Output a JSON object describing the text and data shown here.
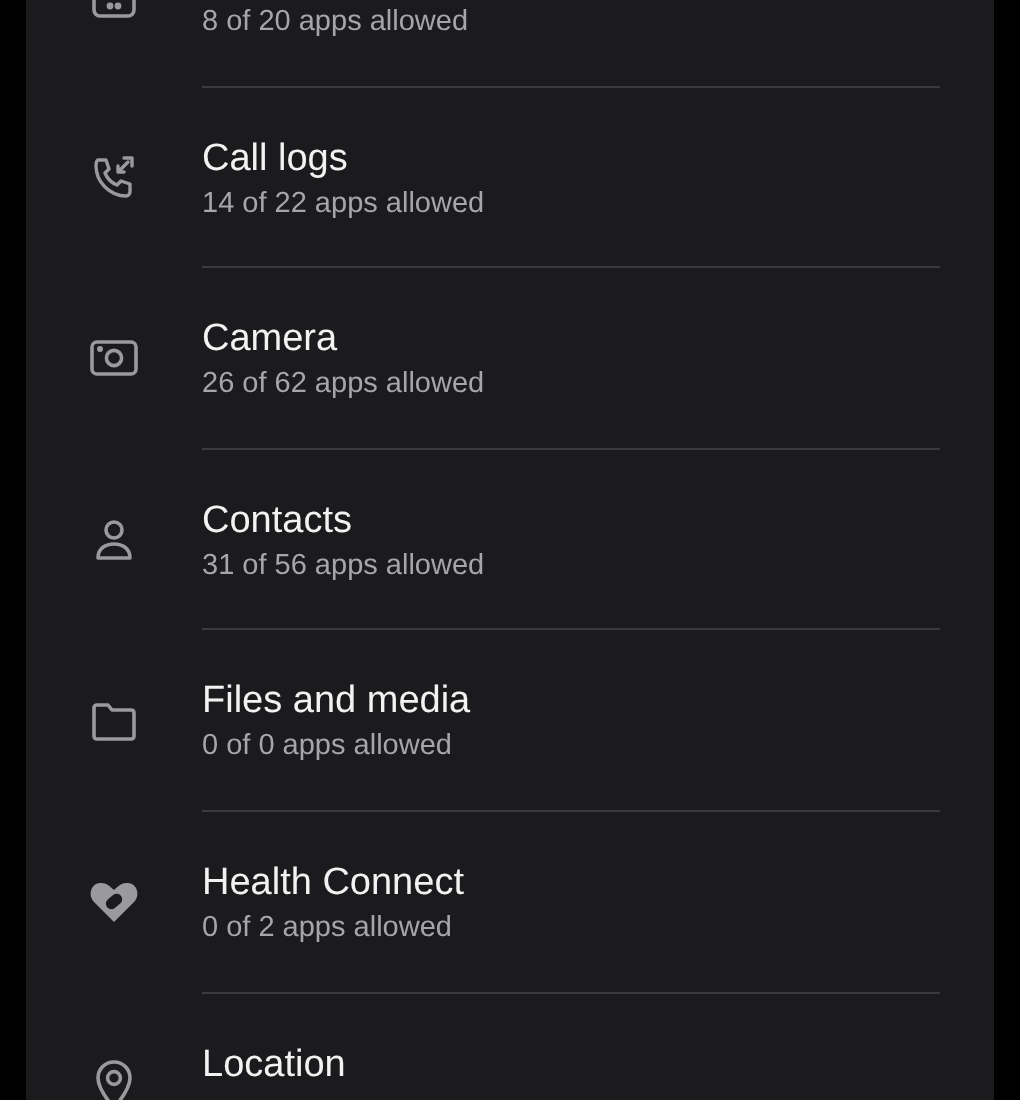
{
  "permissions": [
    {
      "subtitle": "8 of 20 apps allowed"
    },
    {
      "title": "Call logs",
      "subtitle": "14 of 22 apps allowed"
    },
    {
      "title": "Camera",
      "subtitle": "26 of 62 apps allowed"
    },
    {
      "title": "Contacts",
      "subtitle": "31 of 56 apps allowed"
    },
    {
      "title": "Files and media",
      "subtitle": "0 of 0 apps allowed"
    },
    {
      "title": "Health Connect",
      "subtitle": "0 of 2 apps allowed"
    },
    {
      "title": "Location"
    }
  ]
}
